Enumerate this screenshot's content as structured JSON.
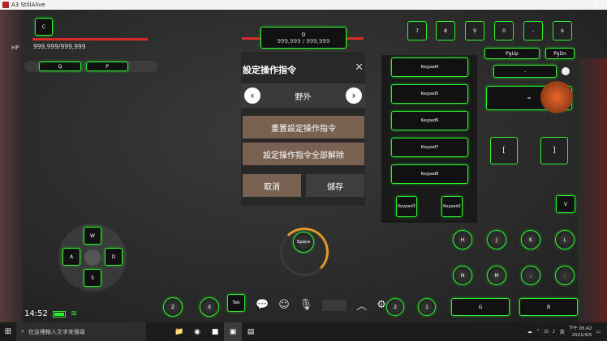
{
  "window": {
    "title": "A3 StillAlive",
    "min": "─",
    "max": "□",
    "close": "✕"
  },
  "hud": {
    "top_key": "C",
    "hp_text": "999,999/999,999",
    "hp_label": "HP",
    "center_key": "0",
    "center_value": "999,999 / 999,999",
    "q_key": "Q",
    "p_key": "P"
  },
  "top_right_keys": [
    "7",
    "8",
    "9",
    "0",
    "-",
    "6"
  ],
  "pg_keys": {
    "pgup": "PgUp",
    "pgdn": "PgDn"
  },
  "minus_key": "-",
  "equals_key": "=",
  "panel": {
    "title": "設定操作指令",
    "close": "✕",
    "prev": "‹",
    "next": "›",
    "selector_value": "野外",
    "reset_label": "重置設定操作指令",
    "clear_label": "設定操作指令全部解除",
    "cancel_label": "取消",
    "save_label": "儲存"
  },
  "keypads": [
    "Keypad4",
    "Keypad5",
    "Keypad6",
    "Keypad7",
    "Keypad8"
  ],
  "keypad_small": [
    "Keypad3",
    "Keypad2"
  ],
  "bracket_keys": [
    "[",
    "]"
  ],
  "right_keys_row1": [
    "H",
    "J",
    "K",
    "L"
  ],
  "right_keys_row2": [
    "N",
    "M",
    ",",
    "."
  ],
  "v_key": "V",
  "dpad": {
    "up": "W",
    "left": "A",
    "right": "D",
    "down": "S"
  },
  "space_label": "Space",
  "bottom_keys": {
    "z": "Z",
    "x": "X",
    "tab": "Tab",
    "two": "2",
    "one": "1",
    "g": "G",
    "b": "B"
  },
  "status": {
    "time": "14:52"
  },
  "taskbar": {
    "search_placeholder": "在這裡輸入文字來搜尋",
    "tray_lang": "英",
    "clock_time": "下午 05:42",
    "clock_date": "2021/9/5"
  }
}
